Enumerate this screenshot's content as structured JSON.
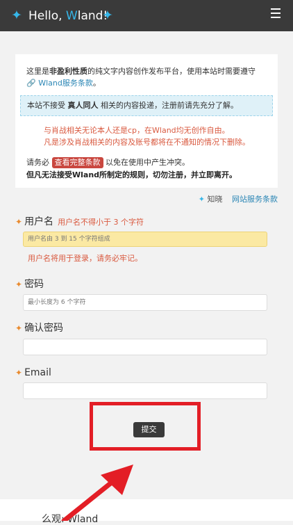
{
  "header": {
    "greeting_prefix": "Hello, ",
    "greeting_w": "W",
    "greeting_suffix": "land!",
    "star_left": "✦",
    "star_right": "✦"
  },
  "notice": {
    "intro_1": "这里是",
    "intro_bold": "非盈利性质",
    "intro_2": "的纯文字内容创作发布平台，使用本站时需要遵守",
    "terms_link": "Wland服务条款",
    "intro_end": "。",
    "blue_1": "本站不接受 ",
    "blue_bold": "真人同人",
    "blue_2": " 相关的内容投递，注册前请先充分了解。",
    "red_line_1": "与肖战相关无论本人还是cp，在Wland均无创作自由。",
    "red_line_2": "凡是涉及肖战相关的内容及账号都将在不通知的情况下删除。",
    "must_1": "请务必 ",
    "must_tag": "查看完整条款",
    "must_2": " 以免在使用中产生冲突。",
    "warning": "但凡无法接受Wland所制定的规则，切勿注册，并立即离开。"
  },
  "links": {
    "know_star": "✦",
    "know": "知晓",
    "tos": "网站服务条款"
  },
  "form": {
    "username": {
      "label": "用户名",
      "hint": "用户名不得小于  3  个字符",
      "placeholder": "用户名由 3 到 15 个字符组成",
      "below": "用户名将用于登录，请务必牢记。"
    },
    "password": {
      "label": "密码",
      "placeholder": "最小长度为 6 个字符"
    },
    "confirm": {
      "label": "确认密码",
      "placeholder": ""
    },
    "email": {
      "label": "Email",
      "placeholder": ""
    },
    "star": "✦",
    "submit": "提交"
  },
  "footer": {
    "partial_text": "么观: Wland"
  },
  "colors": {
    "topbar": "#3a3a3a",
    "accent_blue": "#36b6e8",
    "annotation_red": "#e31e26",
    "hint_red": "#d9593f"
  }
}
